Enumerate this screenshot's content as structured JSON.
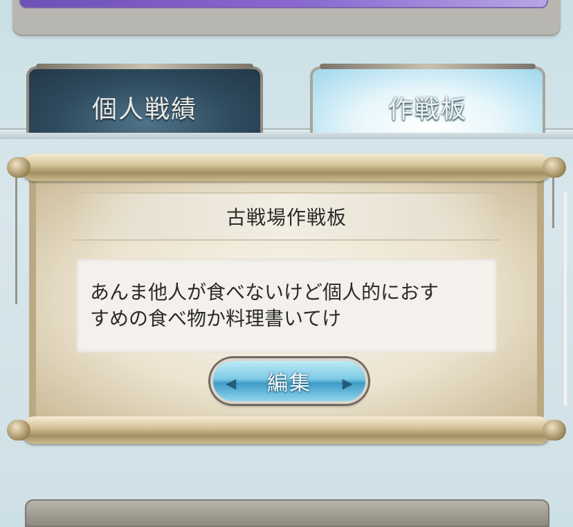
{
  "top_bar": {
    "text": ""
  },
  "tabs": [
    {
      "label": "個人戦績",
      "active": false
    },
    {
      "label": "作戦板",
      "active": true
    }
  ],
  "board": {
    "title": "古戦場作戦板",
    "message_line1": "あんま他人が食べないけど個人的におす",
    "message_line2": "すめの食べ物か料理書いてけ",
    "edit_label": "編集"
  },
  "bottom_panel": {
    "text": ""
  },
  "colors": {
    "inactive_tab": "#2f4b5e",
    "active_tab": "#9ed7ec",
    "edit_button": "#7cc9e6",
    "parchment": "#ece3cf"
  },
  "icons": [
    "chevron-left-ornament",
    "chevron-right-ornament"
  ]
}
